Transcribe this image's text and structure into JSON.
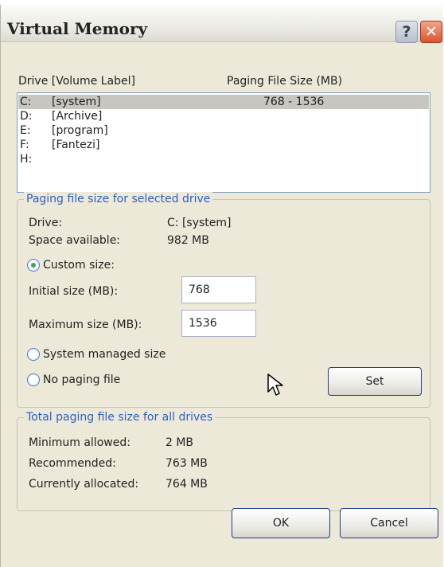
{
  "window": {
    "title": "Virtual Memory",
    "help_button": "?",
    "close_button": "✕"
  },
  "drive_list": {
    "col_drive": "Drive  [Volume Label]",
    "col_paging": "Paging File Size (MB)",
    "rows": [
      {
        "drive": "C:",
        "label": "[system]",
        "size": "768 - 1536",
        "selected": true
      },
      {
        "drive": "D:",
        "label": "[Archive]",
        "size": ""
      },
      {
        "drive": "E:",
        "label": "[program]",
        "size": ""
      },
      {
        "drive": "F:",
        "label": "[Fantezi]",
        "size": ""
      },
      {
        "drive": "H:",
        "label": "",
        "size": ""
      }
    ]
  },
  "selected_drive": {
    "group_title": "Paging file size for selected drive",
    "drive_label": "Drive:",
    "drive_value": "C:  [system]",
    "space_label": "Space available:",
    "space_value": "982 MB",
    "custom_size_label": "Custom size:",
    "initial_label": "Initial size (MB):",
    "initial_value": "768",
    "maximum_label": "Maximum size (MB):",
    "maximum_value": "1536",
    "system_managed_label": "System managed size",
    "no_paging_label": "No paging file",
    "set_button": "Set",
    "selected_option": "custom"
  },
  "totals": {
    "group_title": "Total paging file size for all drives",
    "min_label": "Minimum allowed:",
    "min_value": "2 MB",
    "recommended_label": "Recommended:",
    "recommended_value": "763 MB",
    "allocated_label": "Currently allocated:",
    "allocated_value": "764 MB"
  },
  "buttons": {
    "ok": "OK",
    "cancel": "Cancel"
  },
  "colors": {
    "dialog_bg": "#ece9d8",
    "group_title": "#2f5fc0",
    "selected_row": "#c7c6c0",
    "close_button": "#d9552f"
  }
}
